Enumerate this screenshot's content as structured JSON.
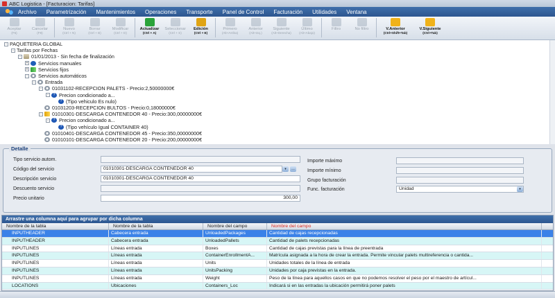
{
  "window": {
    "title": "ABC Logistica - [Facturacion: Tarifas]"
  },
  "menu": [
    "Archivo",
    "Parametrización",
    "Mantenimientos",
    "Operaciones",
    "Transporte",
    "Panel de Control",
    "Facturación",
    "Utilidades",
    "Ventana"
  ],
  "toolbar": [
    {
      "label": "Aceptar",
      "shortcut": "(F5)",
      "state": "disabled",
      "icon": "check-icon",
      "color": "#9aa6b5"
    },
    {
      "label": "Cancelar",
      "shortcut": "(F8)",
      "state": "disabled",
      "icon": "cancel-icon",
      "color": "#9aa6b5"
    },
    {
      "label": "Nuevo",
      "shortcut": "(Ctrl + N)",
      "state": "disabled",
      "icon": "new-icon",
      "color": "#9aa6b5"
    },
    {
      "label": "Borrar",
      "shortcut": "(Ctrl + B)",
      "state": "disabled",
      "icon": "delete-icon",
      "color": "#9aa6b5"
    },
    {
      "label": "Modificar",
      "shortcut": "(Ctrl + D)",
      "state": "disabled",
      "icon": "edit-icon",
      "color": "#9aa6b5"
    },
    {
      "label": "Actualizar",
      "shortcut": "(Ctrl + A)",
      "state": "active",
      "icon": "refresh-icon",
      "color": "#2aa33a"
    },
    {
      "label": "Seleccionar",
      "shortcut": "(Ctrl + S)",
      "state": "disabled",
      "icon": "select-icon",
      "color": "#9aa6b5"
    },
    {
      "label": "Edición",
      "shortcut": "(Ctrl + E)",
      "state": "active",
      "icon": "lock-icon",
      "color": "#e0a414"
    },
    {
      "label": "Primero",
      "shortcut": "(Alt+Arriba)",
      "state": "disabled",
      "icon": "first-icon",
      "color": "#9aa6b5"
    },
    {
      "label": "Anterior",
      "shortcut": "(Alt+Izq.)",
      "state": "disabled",
      "icon": "previous-icon",
      "color": "#9aa6b5"
    },
    {
      "label": "Siguiente",
      "shortcut": "(Alt+Derecha)",
      "state": "disabled",
      "icon": "next-icon",
      "color": "#9aa6b5"
    },
    {
      "label": "Último",
      "shortcut": "(Alt+Abajo)",
      "state": "disabled",
      "icon": "last-icon",
      "color": "#9aa6b5"
    },
    {
      "label": "Filtro",
      "shortcut": "",
      "state": "disabled",
      "icon": "filter-icon",
      "color": "#9aa6b5"
    },
    {
      "label": "No filtro",
      "shortcut": "",
      "state": "disabled",
      "icon": "no-filter-icon",
      "color": "#9aa6b5"
    },
    {
      "label": "V.Anterior",
      "shortcut": "(Ctrl+Shift+Tab)",
      "state": "active",
      "icon": "previous-window-icon",
      "color": "#f0b21a"
    },
    {
      "label": "V.Siguiente",
      "shortcut": "(Ctrl+Tab)",
      "state": "active",
      "icon": "next-window-icon",
      "color": "#f0b21a"
    }
  ],
  "tree": [
    {
      "text": "PAQUETERIA GLOBAL",
      "level": 0,
      "exp": "-",
      "icon": "grid"
    },
    {
      "text": "Tarifas por Fechas",
      "level": 1,
      "exp": "-",
      "icon": "grid"
    },
    {
      "text": "01/01/2013 - Sin fecha de finalización",
      "level": 2,
      "exp": "-",
      "icon": "pkg"
    },
    {
      "text": "Servicios manuales",
      "level": 3,
      "exp": "+",
      "icon": "blue"
    },
    {
      "text": "Servicios fijos",
      "level": 3,
      "exp": "+",
      "icon": "greenarrow"
    },
    {
      "text": "Servicios automáticos",
      "level": 3,
      "exp": "-",
      "icon": "gear"
    },
    {
      "text": "Entrada",
      "level": 4,
      "exp": "-",
      "icon": "gear"
    },
    {
      "text": "01031102-RECEPCION PALETS - Precio:2,50000000€",
      "level": 5,
      "exp": "-",
      "icon": "gear"
    },
    {
      "text": "Precion condicionado a...",
      "level": 6,
      "exp": "-",
      "icon": "q"
    },
    {
      "text": "(Tipo vehiculo Es nulo)",
      "level": 7,
      "exp": "",
      "icon": "q"
    },
    {
      "text": "01031203-RECEPCION BULTOS - Precio:0,18000000€",
      "level": 5,
      "exp": "",
      "icon": "gear"
    },
    {
      "text": "01010301-DESCARGA CONTENEDOR 40 - Precio:300,00000000€",
      "level": 5,
      "exp": "-",
      "icon": "yellowarrow"
    },
    {
      "text": "Precion condicionado a...",
      "level": 6,
      "exp": "-",
      "icon": "q"
    },
    {
      "text": "(Tipo vehículo Igual CONTAINER 40)",
      "level": 7,
      "exp": "",
      "icon": "q"
    },
    {
      "text": "01010401-DESCARGA CONTENEDOR 45 - Precio:350,00000000€",
      "level": 5,
      "exp": "",
      "icon": "gear"
    },
    {
      "text": "01010101-DESCARGA CONTENEDOR 20 - Precio:200,00000000€",
      "level": 5,
      "exp": "",
      "icon": "gear"
    }
  ],
  "detalle": {
    "title": "Detalle",
    "left": [
      {
        "label": "Tipo servicio autom.",
        "value": ""
      },
      {
        "label": "Código del servicio",
        "value": "01010301-DESCARGA CONTENEDOR 40"
      },
      {
        "label": "Descripción servicio",
        "value": "01010301-DESCARGA CONTENEDOR 40"
      },
      {
        "label": "Descuento servicio",
        "value": ""
      },
      {
        "label": "Precio unitario",
        "value": "300,00"
      }
    ],
    "right": [
      {
        "label": "Importe máximo",
        "value": ""
      },
      {
        "label": "Importe mínimo",
        "value": ""
      },
      {
        "label": "Grupo facturación",
        "value": ""
      },
      {
        "label": "Func. facturación",
        "value": "Unidad"
      }
    ]
  },
  "grid": {
    "group_hint": "Arrastre una columna aquí para agrupar por dicha columna",
    "headers": [
      "Nombre de la tabla",
      "Nombre de la tabla",
      "Nombre del campo",
      "Nombre del campo"
    ],
    "rows": [
      [
        "INPUTHEADER",
        "Cabecera entrada",
        "UnloadedPackages",
        "Cantidad de cajas recepcionadas"
      ],
      [
        "INPUTHEADER",
        "Cabecera entrada",
        "UnloadedPallets",
        "Cantidad de palets recepcionadas"
      ],
      [
        "INPUTLINES",
        "Líneas entrada",
        "Boxes",
        "Cantidad de cajas previstas para la línea de preentrada"
      ],
      [
        "INPUTLINES",
        "Líneas entrada",
        "ContainerEnrollmentA...",
        "Matrícula asignada a la hora de crear la entrada. Permite vincular palets multireferencia o cantida..."
      ],
      [
        "INPUTLINES",
        "Líneas entrada",
        "Units",
        "Unidades totales de la línea de entrada"
      ],
      [
        "INPUTLINES",
        "Líneas entrada",
        "UnitsPacking",
        "Unidades por caja previstas en la entrada."
      ],
      [
        "INPUTLINES",
        "Líneas entrada",
        "Weight",
        "Peso de la línea para aquellos casos en que no podemos resolver el peso por el maestro de artícul..."
      ],
      [
        "LOCATIONS",
        "Ubicaciones",
        "Containers_Loc",
        "Indicará si en las entradas la ubicación permitirá poner palets"
      ]
    ]
  }
}
